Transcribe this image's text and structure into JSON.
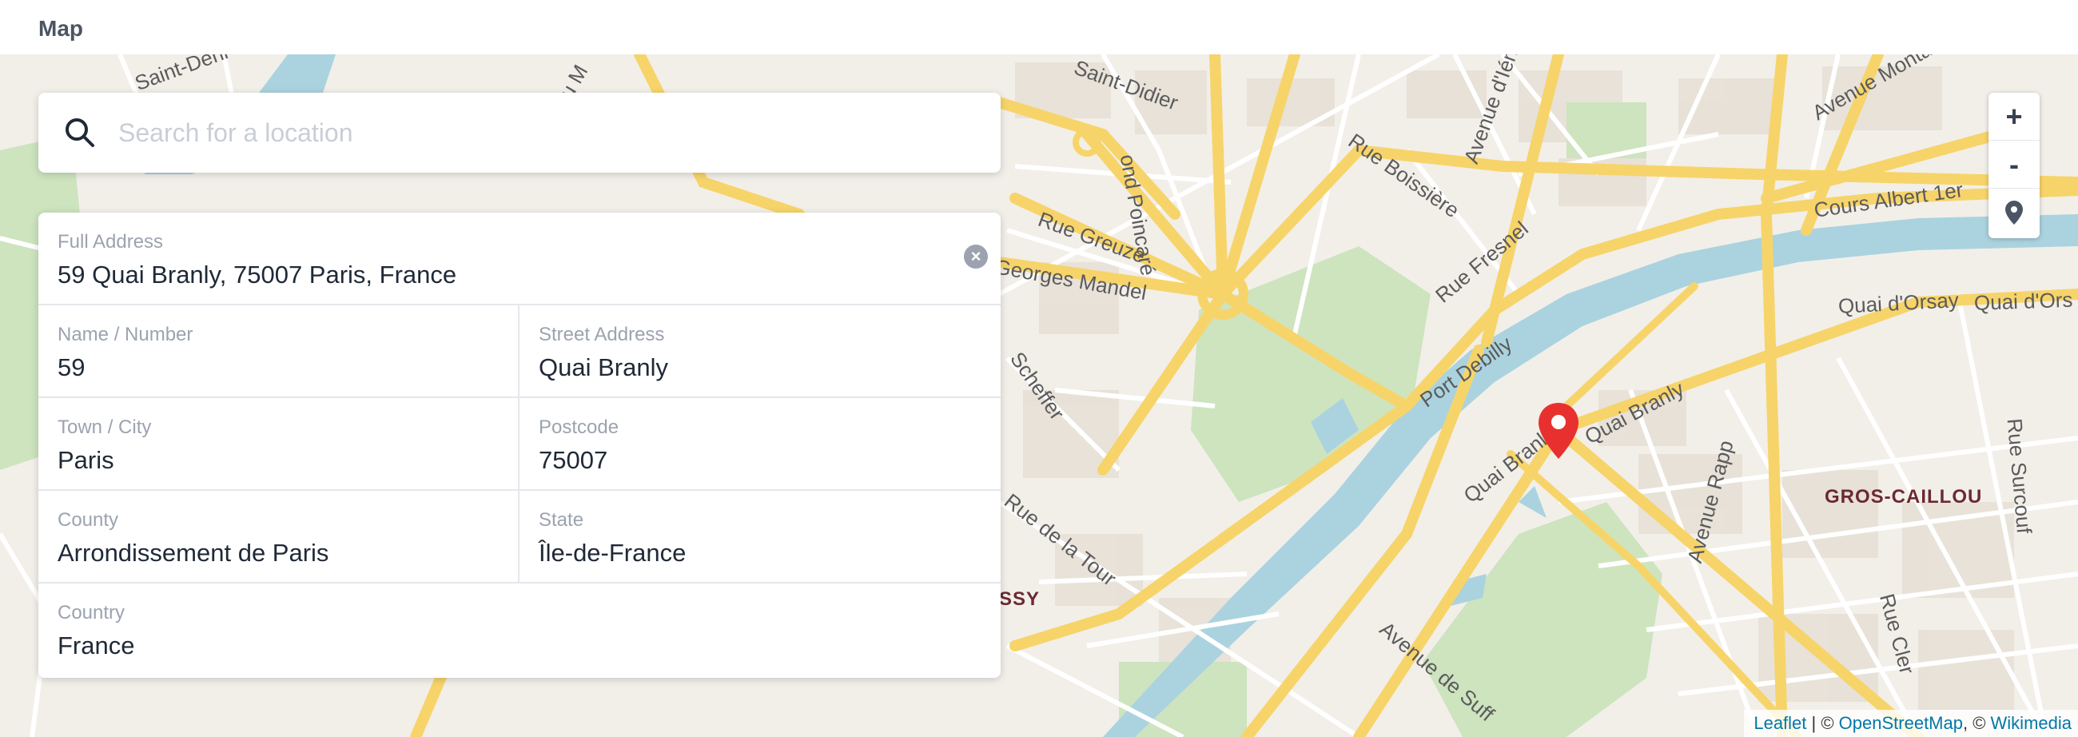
{
  "header": {
    "title": "Map"
  },
  "search": {
    "placeholder": "Search for a location",
    "value": ""
  },
  "address": {
    "full_address": {
      "label": "Full Address",
      "value": "59 Quai Branly, 75007 Paris, France"
    },
    "name_number": {
      "label": "Name / Number",
      "value": "59"
    },
    "street_address": {
      "label": "Street Address",
      "value": "Quai Branly"
    },
    "town_city": {
      "label": "Town / City",
      "value": "Paris"
    },
    "postcode": {
      "label": "Postcode",
      "value": "75007"
    },
    "county": {
      "label": "County",
      "value": "Arrondissement de Paris"
    },
    "state": {
      "label": "State",
      "value": "Île-de-France"
    },
    "country": {
      "label": "Country",
      "value": "France"
    }
  },
  "map": {
    "zoom_in_label": "+",
    "zoom_out_label": "-",
    "locate_icon": "location-pin-icon",
    "marker_color": "#e8312f",
    "road_color": "#f7d46a",
    "water_color": "#aad3df",
    "park_color": "#cde4bf",
    "labels": [
      "Rue Boissière",
      "Avenue d'Iéna",
      "Avenue Montaigne",
      "Cours Albert 1er",
      "Rue Greuze",
      "Georges Mandel",
      "Rue Fresnel",
      "Quai d'Orsay",
      "Quai d'Ors",
      "Port Debilly",
      "Quai Branly",
      "Quai Branly",
      "Scheffer",
      "Rue de la Tour",
      "Avenue Rapp",
      "GROS-CAILLOU",
      "Rue Cler",
      "Avenue de Suff",
      "SSY",
      "Saint-Didier",
      "Saint-Deni",
      "ond Poincaré",
      "Rue Surcouf",
      "du M"
    ]
  },
  "attribution": {
    "leaflet": "Leaflet",
    "separator": " | © ",
    "osm": "OpenStreetMap",
    "comma": ", © ",
    "wikimedia": "Wikimedia"
  }
}
